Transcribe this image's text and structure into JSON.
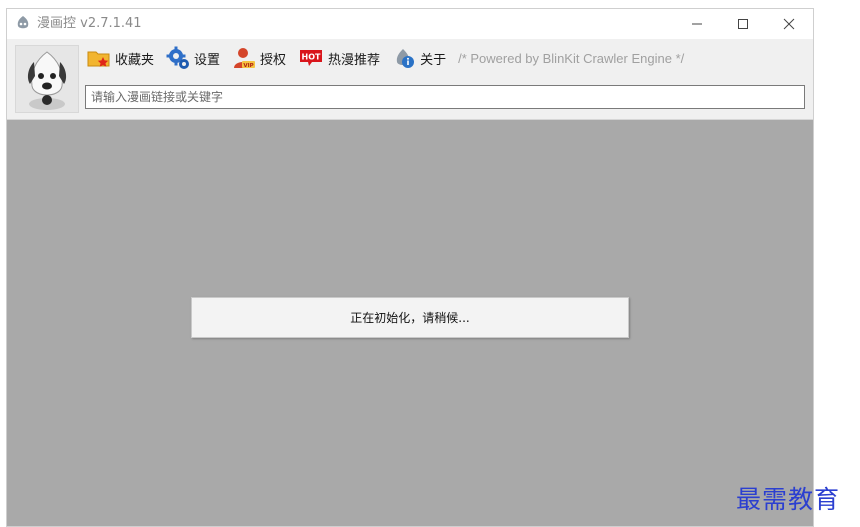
{
  "window": {
    "title": "漫画控 v2.7.1.41",
    "controls": {
      "minimize": "minimize",
      "maximize": "maximize",
      "close": "close"
    }
  },
  "toolbar": {
    "items": [
      {
        "label": "收藏夹",
        "icon": "favorites-folder-icon"
      },
      {
        "label": "设置",
        "icon": "settings-gear-icon"
      },
      {
        "label": "授权",
        "icon": "vip-user-icon"
      },
      {
        "label": "热漫推荐",
        "icon": "hot-badge-icon",
        "badge": "HOT"
      },
      {
        "label": "关于",
        "icon": "about-info-icon"
      }
    ],
    "powered_by": "/* Powered by BlinKit Crawler Engine */"
  },
  "search": {
    "placeholder": "请输入漫画链接或关键字",
    "value": ""
  },
  "status": {
    "loading_text": "正在初始化，请稍候..."
  },
  "watermark": "最需教育",
  "colors": {
    "content_bg": "#a9a9a9",
    "toolbar_bg": "#f0f0f0",
    "watermark": "#2b3fd0",
    "hot_badge": "#d9151b"
  }
}
